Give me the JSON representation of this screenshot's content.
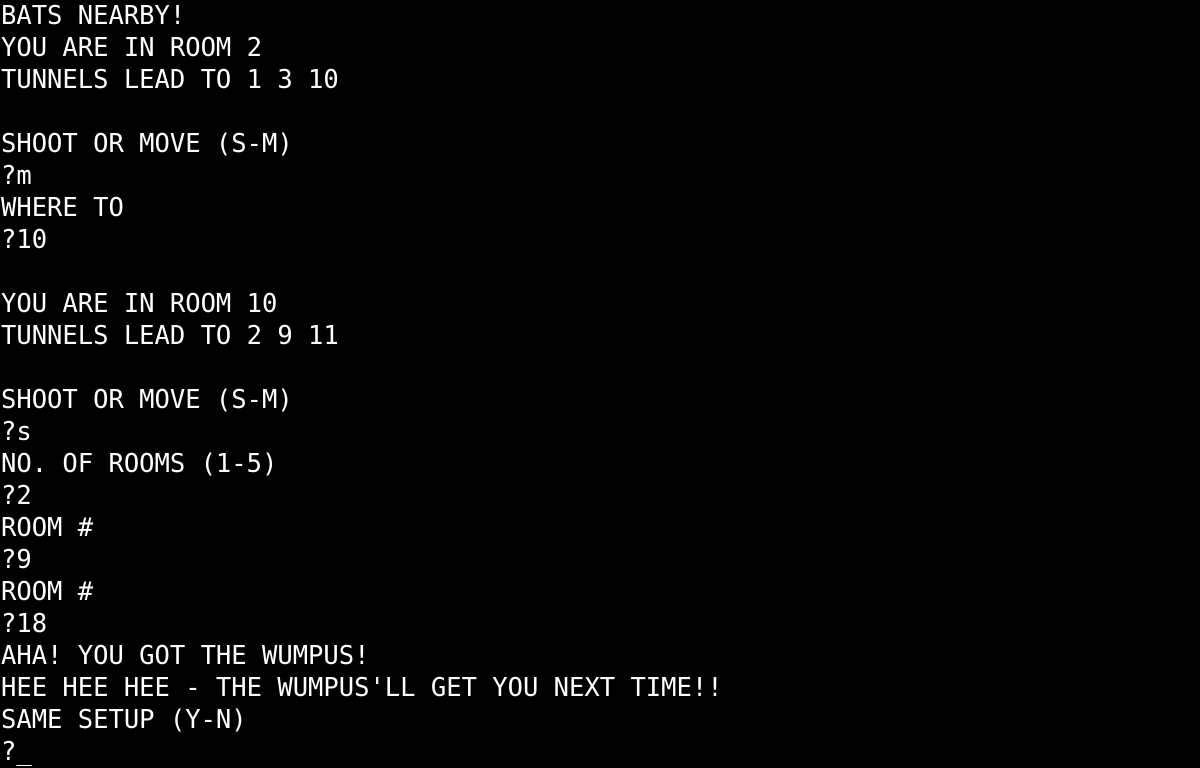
{
  "terminal": {
    "colors": {
      "background": "#000000",
      "foreground": "#ffffff"
    },
    "lines": [
      "BATS NEARBY!",
      "YOU ARE IN ROOM 2",
      "TUNNELS LEAD TO 1 3 10",
      "",
      "SHOOT OR MOVE (S-M)",
      "?m",
      "WHERE TO",
      "?10",
      "",
      "YOU ARE IN ROOM 10",
      "TUNNELS LEAD TO 2 9 11",
      "",
      "SHOOT OR MOVE (S-M)",
      "?s",
      "NO. OF ROOMS (1-5)",
      "?2",
      "ROOM #",
      "?9",
      "ROOM #",
      "?18",
      "AHA! YOU GOT THE WUMPUS!",
      "HEE HEE HEE - THE WUMPUS'LL GET YOU NEXT TIME!!",
      "SAME SETUP (Y-N)"
    ],
    "prompt": "?",
    "cursor": "_"
  }
}
